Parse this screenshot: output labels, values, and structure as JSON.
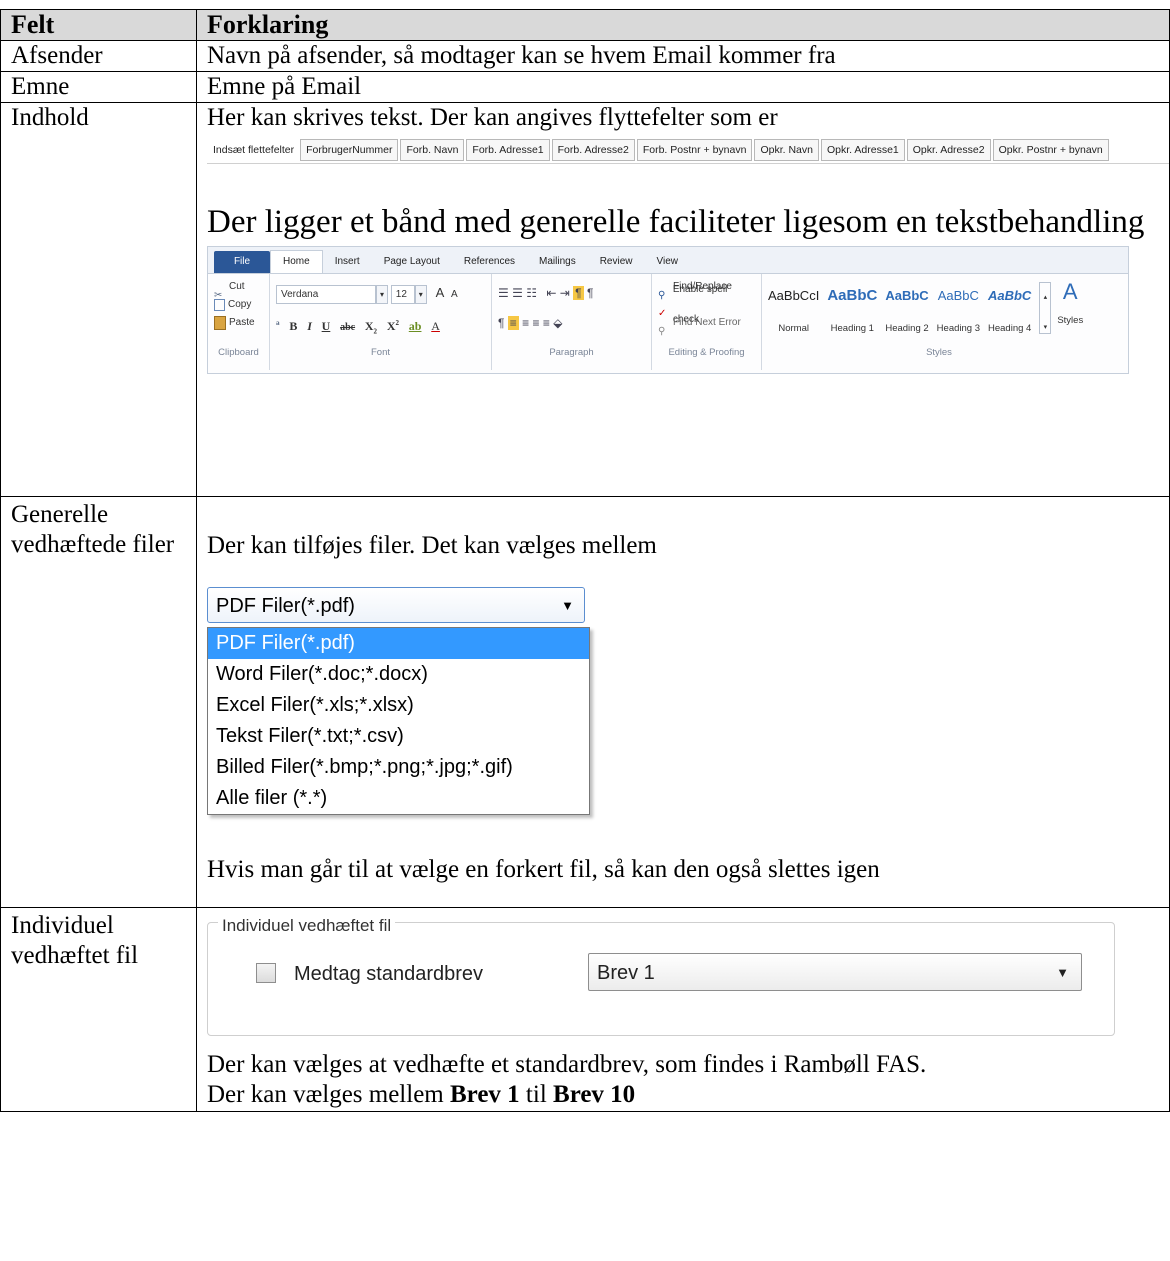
{
  "table": {
    "headers": {
      "felt": "Felt",
      "forklaring": "Forklaring"
    },
    "rows": {
      "afsender": {
        "felt": "Afsender",
        "forklaring": "Navn på afsender, så modtager kan se hvem Email kommer fra"
      },
      "emne": {
        "felt": "Emne",
        "forklaring": "Emne på Email"
      },
      "indhold": {
        "felt": "Indhold",
        "text1": "Her kan skrives tekst. Der kan angives flyttefelter som er",
        "mergebar": {
          "label": "Indsæt flettefelter",
          "fields": [
            "ForbrugerNummer",
            "Forb. Navn",
            "Forb. Adresse1",
            "Forb. Adresse2",
            "Forb. Postnr + bynavn",
            "Opkr. Navn",
            "Opkr. Adresse1",
            "Opkr. Adresse2",
            "Opkr. Postnr + bynavn"
          ]
        },
        "text2": "Der ligger et bånd med generelle faciliteter ligesom en tekstbehandling",
        "ribbon": {
          "tabs": [
            "File",
            "Home",
            "Insert",
            "Page Layout",
            "References",
            "Mailings",
            "Review",
            "View"
          ],
          "clipboard": {
            "cut": "Cut",
            "copy": "Copy",
            "paste": "Paste",
            "name": "Clipboard"
          },
          "font": {
            "family": "Verdana",
            "size": "12",
            "grow": "A",
            "shrink": "A",
            "name": "Font"
          },
          "paragraph": {
            "name": "Paragraph"
          },
          "editing": {
            "find": "Find/Replace",
            "spell": "Enable spell check",
            "next": "Find Next Error",
            "name": "Editing & Proofing"
          },
          "styles": {
            "items": [
              {
                "sample": "AaBbCcI",
                "caption": "Normal"
              },
              {
                "sample": "AaBbC",
                "caption": "Heading 1"
              },
              {
                "sample": "AaBbC",
                "caption": "Heading 2"
              },
              {
                "sample": "AaBbC",
                "caption": "Heading 3"
              },
              {
                "sample": "AaBbC",
                "caption": "Heading 4"
              }
            ],
            "button": "Styles",
            "name": "Styles"
          }
        }
      },
      "vedhaeftede": {
        "felt": "Generelle vedhæftede filer",
        "text1": "Der kan tilføjes filer. Det kan vælges mellem",
        "combo_value": "PDF Filer(*.pdf)",
        "options": [
          "PDF Filer(*.pdf)",
          "Word Filer(*.doc;*.docx)",
          "Excel Filer(*.xls;*.xlsx)",
          "Tekst Filer(*.txt;*.csv)",
          "Billed Filer(*.bmp;*.png;*.jpg;*.gif)",
          "Alle filer (*.*)"
        ],
        "text2": "Hvis man går til at vælge en forkert fil, så kan den også slettes igen"
      },
      "individuel": {
        "felt": "Individuel vedhæftet fil",
        "group_legend": "Individuel vedhæftet fil",
        "checkbox_label": "Medtag standardbrev",
        "select_value": "Brev 1",
        "text1": "Der kan vælges at vedhæfte et standardbrev, som findes i Rambøll FAS.",
        "text2_a": "Der kan vælges mellem ",
        "text2_b": "Brev 1",
        "text2_c": " til ",
        "text2_d": "Brev 10"
      }
    }
  }
}
